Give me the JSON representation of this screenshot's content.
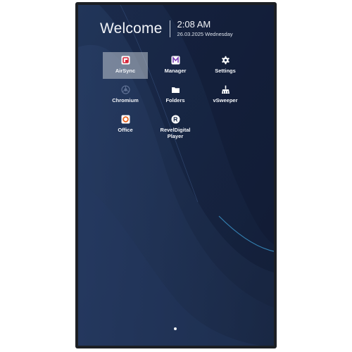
{
  "header": {
    "welcome": "Welcome",
    "time": "2:08 AM",
    "date": "26.03.2025 Wednesday"
  },
  "apps": [
    {
      "label": "AirSync",
      "icon": "airsync-icon",
      "selected": true
    },
    {
      "label": "Manager",
      "icon": "manager-icon",
      "selected": false
    },
    {
      "label": "Settings",
      "icon": "gear-icon",
      "selected": false
    },
    {
      "label": "Chromium",
      "icon": "chromium-icon",
      "selected": false
    },
    {
      "label": "Folders",
      "icon": "folder-icon",
      "selected": false
    },
    {
      "label": "vSweeper",
      "icon": "sweeper-icon",
      "selected": false
    },
    {
      "label": "Office",
      "icon": "office-icon",
      "selected": false
    },
    {
      "label": "RevelDigital Player",
      "icon": "reveldigital-icon",
      "selected": false
    }
  ],
  "pager": {
    "current_page": 1,
    "total_pages": 1
  },
  "colors": {
    "background": "#1b2c4c",
    "bezel": "#1c1f24",
    "selection": "#bec4ce",
    "text": "#f2f4f8"
  }
}
